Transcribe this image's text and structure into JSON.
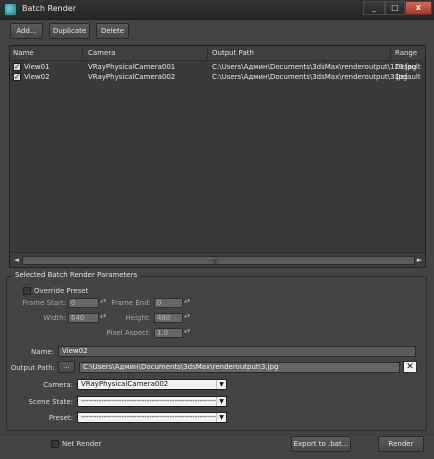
{
  "window": {
    "title": "Batch Render",
    "minimize": "_",
    "maximize": "□",
    "close": "x"
  },
  "toolbar": {
    "add_label": "Add...",
    "duplicate_label": "Duplicate",
    "delete_label": "Delete"
  },
  "list": {
    "columns": [
      "Name",
      "Camera",
      "Output Path",
      "Range"
    ],
    "rows": [
      {
        "checked": true,
        "name": "View01",
        "camera": "VRayPhysicalCamera001",
        "output": "C:\\Users\\Админ\\Documents\\3dsMax\\renderoutput\\123.jpg",
        "range": "Default"
      },
      {
        "checked": true,
        "name": "View02",
        "camera": "VRayPhysicalCamera002",
        "output": "C:\\Users\\Админ\\Documents\\3dsMax\\renderoutput\\3.jpg",
        "range": "Default"
      }
    ],
    "scroll_left": "◄",
    "scroll_right": "►",
    "scroll_grip": "|||"
  },
  "params": {
    "group_title": "Selected Batch Render Parameters",
    "override_preset_label": "Override Preset",
    "frame_start_label": "Frame Start:",
    "frame_start_value": "0",
    "frame_end_label": "Frame End:",
    "frame_end_value": "0",
    "width_label": "Width:",
    "width_value": "640",
    "height_label": "Height:",
    "height_value": "480",
    "pixel_aspect_label": "Pixel Aspect:",
    "pixel_aspect_value": "1.0",
    "name_label": "Name:",
    "name_value": "View02",
    "output_path_label": "Output Path:",
    "output_browse_label": "...",
    "output_path_value": "C:\\Users\\Админ\\Documents\\3dsMax\\renderoutput\\3.jpg",
    "clear_icon": "✕",
    "camera_label": "Camera:",
    "camera_value": "VRayPhysicalCamera002",
    "scene_state_label": "Scene State:",
    "scene_state_value": "-----------------------------------------------------------",
    "preset_label": "Preset:",
    "preset_value": "-----------------------------------------------------------",
    "spinner_glyph": "▲▼",
    "dropdown_glyph": "▼"
  },
  "footer": {
    "net_render_label": "Net Render",
    "export_label": "Export to .bat...",
    "render_label": "Render"
  }
}
